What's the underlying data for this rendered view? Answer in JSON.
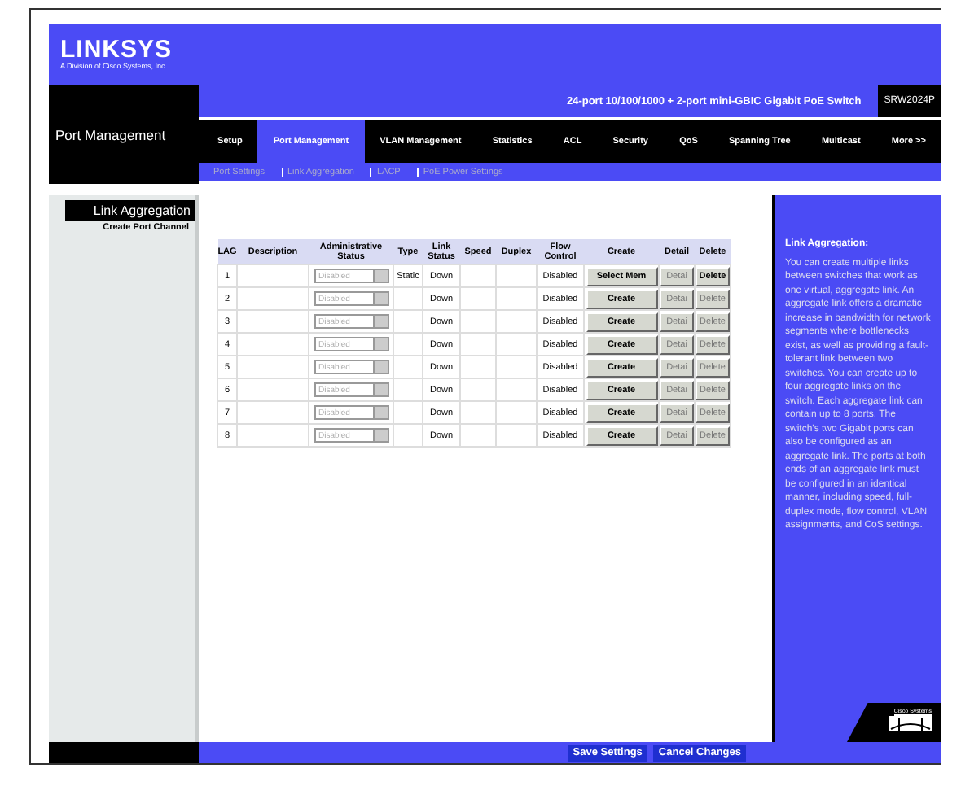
{
  "logo": {
    "name": "LINKSYS",
    "tagline": "A Division of Cisco Systems, Inc."
  },
  "section_title": "Port Management",
  "product_title": "24-port 10/100/1000 + 2-port mini-GBIC Gigabit PoE Switch",
  "model": "SRW2024P",
  "tabs": [
    {
      "label": "Setup",
      "selected": false
    },
    {
      "label": "Port Management",
      "selected": true
    },
    {
      "label": "VLAN Management",
      "selected": false
    },
    {
      "label": "Statistics",
      "selected": false
    },
    {
      "label": "ACL",
      "selected": false
    },
    {
      "label": "Security",
      "selected": false
    },
    {
      "label": "QoS",
      "selected": false
    },
    {
      "label": "Spanning Tree",
      "selected": false
    },
    {
      "label": "Multicast",
      "selected": false
    },
    {
      "label": "More >>",
      "selected": false
    }
  ],
  "subtabs": [
    "Port Settings",
    "Link Aggregation",
    "LACP",
    "PoE Power Settings"
  ],
  "sidebar": {
    "heading": "Link Aggregation",
    "items": [
      "Create Port Channel"
    ]
  },
  "table": {
    "columns": [
      "LAG",
      "Description",
      "Administrative Status",
      "Type",
      "Link Status",
      "Speed",
      "Duplex",
      "Flow Control",
      "Create",
      "Detail",
      "Delete"
    ],
    "rows": [
      {
        "lag": "1",
        "admin_status": {
          "value": "Disabled",
          "disabled": true
        },
        "type": "Static",
        "link_status": "Down",
        "flow_control": "Disabled",
        "create": "Select Mem",
        "detail": {
          "label": "Detai",
          "disabled": true
        },
        "delete": {
          "label": "Delete",
          "disabled": false
        }
      },
      {
        "lag": "2",
        "admin_status": {
          "value": "Disabled",
          "disabled": true
        },
        "link_status": "Down",
        "flow_control": "Disabled",
        "create": "Create",
        "detail": {
          "label": "Detai",
          "disabled": true
        },
        "delete": {
          "label": "Delete",
          "disabled": true
        }
      },
      {
        "lag": "3",
        "admin_status": {
          "value": "Disabled",
          "disabled": true
        },
        "link_status": "Down",
        "flow_control": "Disabled",
        "create": "Create",
        "detail": {
          "label": "Detai",
          "disabled": true
        },
        "delete": {
          "label": "Delete",
          "disabled": true
        }
      },
      {
        "lag": "4",
        "admin_status": {
          "value": "Disabled",
          "disabled": true
        },
        "link_status": "Down",
        "flow_control": "Disabled",
        "create": "Create",
        "detail": {
          "label": "Detai",
          "disabled": true
        },
        "delete": {
          "label": "Delete",
          "disabled": true
        }
      },
      {
        "lag": "5",
        "admin_status": {
          "value": "Disabled",
          "disabled": true
        },
        "link_status": "Down",
        "flow_control": "Disabled",
        "create": "Create",
        "detail": {
          "label": "Detai",
          "disabled": true
        },
        "delete": {
          "label": "Delete",
          "disabled": true
        }
      },
      {
        "lag": "6",
        "admin_status": {
          "value": "Disabled",
          "disabled": true
        },
        "link_status": "Down",
        "flow_control": "Disabled",
        "create": "Create",
        "detail": {
          "label": "Detai",
          "disabled": true
        },
        "delete": {
          "label": "Delete",
          "disabled": true
        }
      },
      {
        "lag": "7",
        "admin_status": {
          "value": "Disabled",
          "disabled": true
        },
        "link_status": "Down",
        "flow_control": "Disabled",
        "create": "Create",
        "detail": {
          "label": "Detai",
          "disabled": true
        },
        "delete": {
          "label": "Delete",
          "disabled": true
        }
      },
      {
        "lag": "8",
        "admin_status": {
          "value": "Disabled",
          "disabled": true
        },
        "link_status": "Down",
        "flow_control": "Disabled",
        "create": "Create",
        "detail": {
          "label": "Detai",
          "disabled": true
        },
        "delete": {
          "label": "Delete",
          "disabled": true
        }
      }
    ]
  },
  "help": {
    "title": "Link Aggregation:",
    "body": "You can create multiple links between switches that work as one virtual, aggregate link. An aggregate link offers a dramatic increase in bandwidth for network segments where bottlenecks exist, as well as providing a fault-tolerant link between two switches. You can create up to four aggregate links on the switch. Each aggregate link can contain up to 8 ports. The switch's two Gigabit ports can also be configured as an aggregate link. The ports at both ends of an aggregate link must be configured in an identical manner, including speed, full-duplex mode, flow control, VLAN assignments, and CoS settings."
  },
  "brand_mark": "Cisco Systems",
  "footer_buttons": [
    "Save Settings",
    "Cancel Changes"
  ]
}
